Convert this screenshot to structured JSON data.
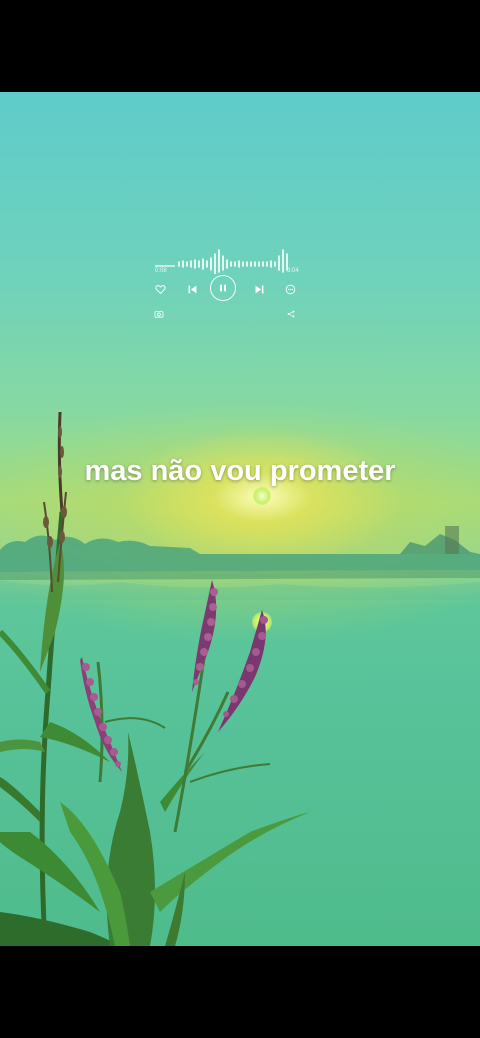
{
  "player": {
    "time_elapsed": "0:08",
    "time_total": "3:04",
    "progress": 0.12,
    "like_icon": "heart-icon",
    "prev_icon": "skip-previous-icon",
    "pause_icon": "pause-icon",
    "next_icon": "skip-next-icon",
    "more_icon": "more-circle-icon",
    "camera_icon": "camera-icon",
    "share_icon": "share-icon"
  },
  "lyric": {
    "text": "mas não vou prometer"
  },
  "colors": {
    "sky_top": "#5fcccb",
    "horizon_glow": "#e6e25a",
    "water": "#4fbc8c",
    "lyric_text": "#ffffff"
  }
}
